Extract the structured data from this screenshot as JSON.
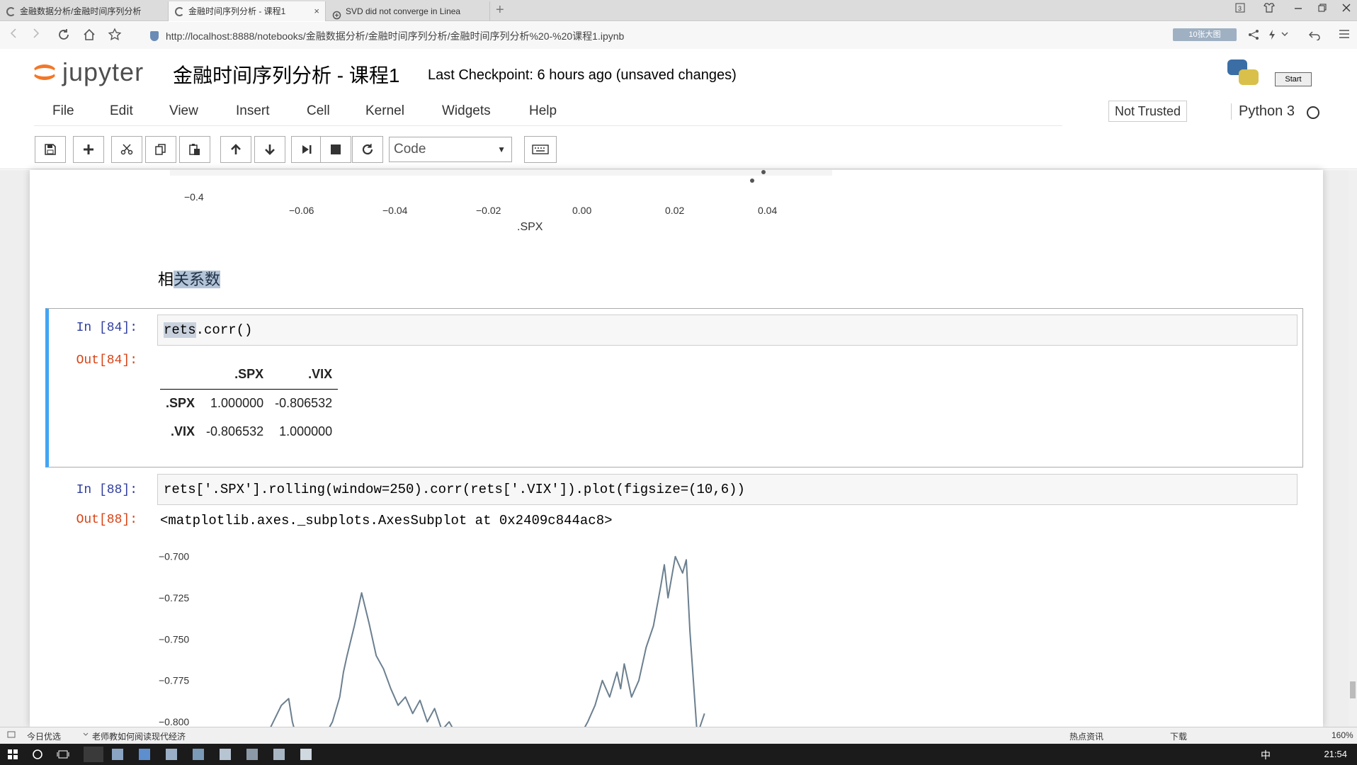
{
  "browser": {
    "tabs": [
      {
        "label": "金融数据分析/金融时间序列分析",
        "active": false
      },
      {
        "label": "金融时间序列分析 - 课程1",
        "active": true
      },
      {
        "label": "SVD did not converge in Linea",
        "active": false
      }
    ],
    "tab_close": "×",
    "new_tab": "+",
    "url": "http://localhost:8888/notebooks/金融数据分析/金融时间序列分析/金融时间序列分析%20-%20课程1.ipynb",
    "badge": "10张大图"
  },
  "jupyter": {
    "logo_text": "jupyter",
    "notebook_title": "金融时间序列分析 - 课程1",
    "checkpoint": "Last Checkpoint: 6 hours ago (unsaved changes)",
    "start_label": "Start",
    "menu": [
      "File",
      "Edit",
      "View",
      "Insert",
      "Cell",
      "Kernel",
      "Widgets",
      "Help"
    ],
    "trust": "Not Trusted",
    "kernel": "Python 3",
    "cell_type": "Code"
  },
  "toolbar_icons": [
    "save-icon",
    "plus-icon",
    "cut-icon",
    "copy-icon",
    "paste-icon",
    "arrow-up-icon",
    "arrow-down-icon",
    "run-icon",
    "stop-icon",
    "restart-icon"
  ],
  "scatter_axis": {
    "y_tick": "−0.4",
    "x_ticks": [
      "−0.06",
      "−0.04",
      "−0.02",
      "0.00",
      "0.02",
      "0.04"
    ],
    "x_label": ".SPX"
  },
  "markdown": {
    "plain": "相",
    "selected": "关系数"
  },
  "cell84": {
    "in_prompt": "In  [84]:",
    "code_hl": "rets",
    "code_rest": ".corr()",
    "out_prompt": "Out[84]:",
    "table": {
      "columns": [
        ".SPX",
        ".VIX"
      ],
      "rows": [
        {
          "index": ".SPX",
          "values": [
            "1.000000",
            "-0.806532"
          ]
        },
        {
          "index": ".VIX",
          "values": [
            "-0.806532",
            "1.000000"
          ]
        }
      ]
    }
  },
  "cell88": {
    "in_prompt": "In  [88]:",
    "code": "rets['.SPX'].rolling(window=250).corr(rets['.VIX']).plot(figsize=(10,6))",
    "out_prompt": "Out[88]:",
    "out_text": "<matplotlib.axes._subplots.AxesSubplot at 0x2409c844ac8>"
  },
  "chart_data": {
    "type": "line",
    "title": "",
    "xlabel": "",
    "ylabel": "",
    "y_ticks": [
      "−0.700",
      "−0.725",
      "−0.750",
      "−0.775",
      "−0.800"
    ],
    "ylim": [
      -0.806,
      -0.692
    ],
    "xlim": [
      0,
      100
    ],
    "color": "#6b7f8f",
    "series": [
      {
        "x": [
          9,
          10,
          11,
          12,
          12.5,
          13,
          14,
          15,
          17,
          18,
          19,
          19.5,
          20,
          21,
          22,
          23,
          24,
          25,
          26,
          27,
          28,
          29,
          30,
          31,
          32,
          33,
          34,
          35,
          52,
          53,
          54,
          55,
          56,
          57,
          57.5,
          58,
          59,
          60,
          61,
          62,
          63,
          63.5,
          64,
          65,
          66,
          66.5,
          67,
          68,
          69
        ],
        "y": [
          -0.808,
          -0.799,
          -0.79,
          -0.786,
          -0.8,
          -0.808,
          -0.808,
          -0.808,
          -0.808,
          -0.8,
          -0.785,
          -0.77,
          -0.76,
          -0.742,
          -0.722,
          -0.74,
          -0.76,
          -0.768,
          -0.78,
          -0.79,
          -0.785,
          -0.795,
          -0.787,
          -0.8,
          -0.792,
          -0.805,
          -0.8,
          -0.808,
          -0.808,
          -0.8,
          -0.79,
          -0.775,
          -0.785,
          -0.77,
          -0.78,
          -0.765,
          -0.785,
          -0.775,
          -0.755,
          -0.742,
          -0.718,
          -0.705,
          -0.725,
          -0.7,
          -0.71,
          -0.702,
          -0.745,
          -0.808,
          -0.795
        ]
      }
    ]
  },
  "statusbar": {
    "left1": "今日优选",
    "left2": "老师教如何阅读现代经济",
    "right": [
      "热点资讯",
      "下载"
    ],
    "zoom": "160%"
  },
  "taskbar": {
    "ime": "中",
    "time": "21:54"
  }
}
